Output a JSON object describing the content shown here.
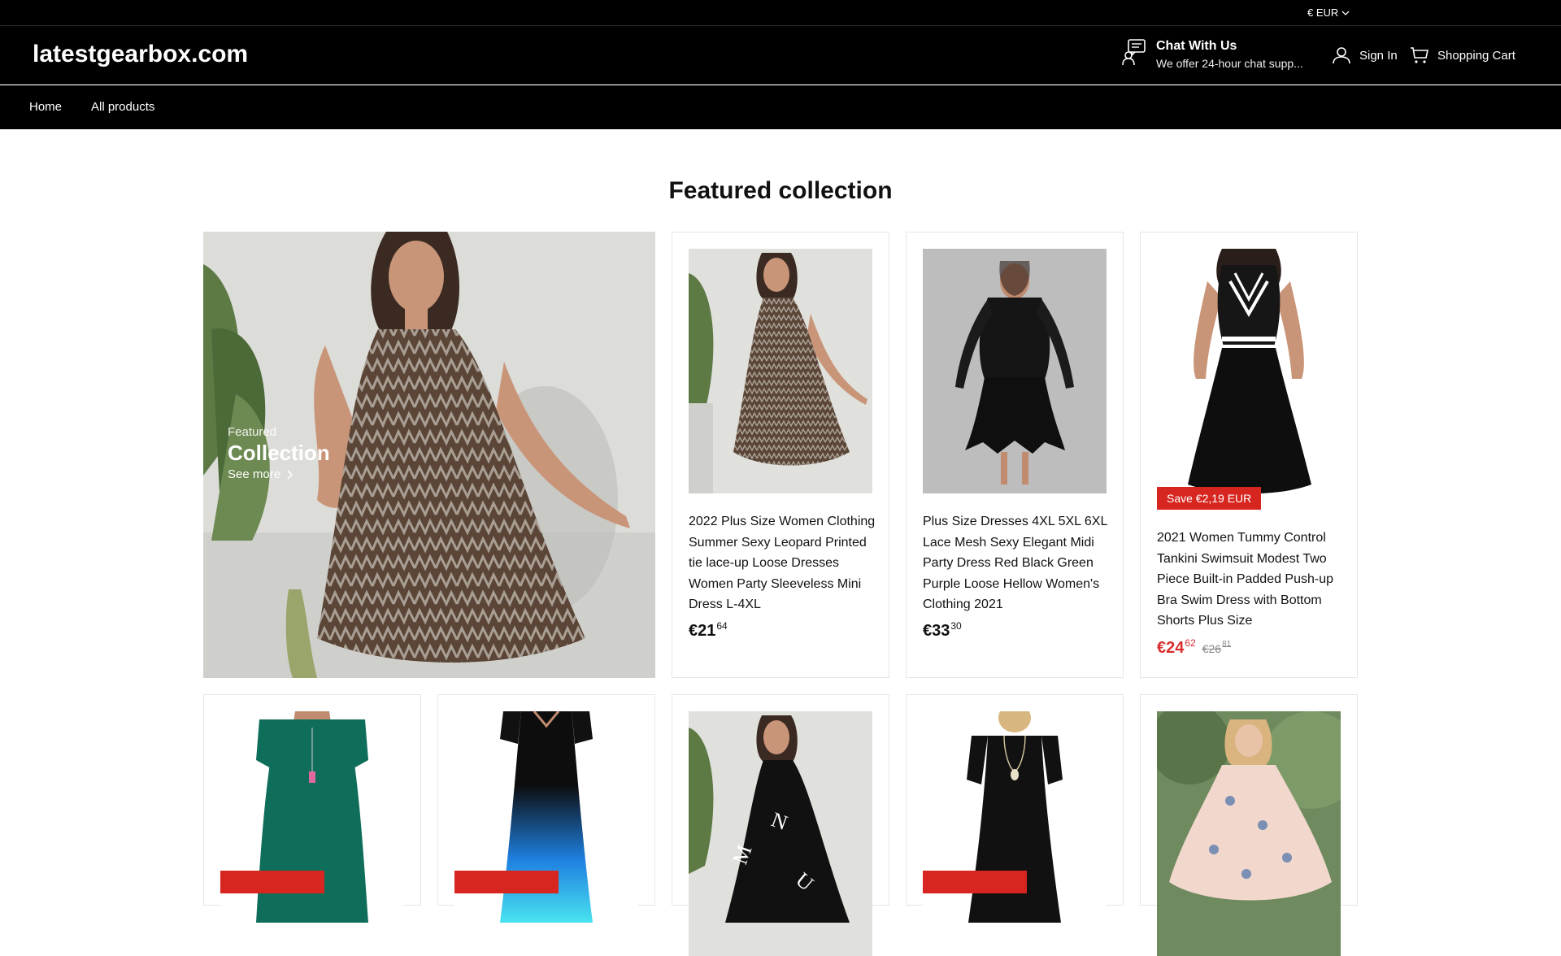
{
  "topbar": {
    "currency": "€ EUR"
  },
  "header": {
    "logo": "latestgearbox.com",
    "chat_title": "Chat With Us",
    "chat_subtitle": "We offer 24-hour chat supp...",
    "sign_in": "Sign In",
    "cart": "Shopping Cart"
  },
  "nav": {
    "items": [
      "Home",
      "All products"
    ]
  },
  "section": {
    "title": "Featured collection"
  },
  "feature": {
    "kicker": "Featured",
    "title": "Collection",
    "link": "See more"
  },
  "products": [
    {
      "title": "2022 Plus Size Women Clothing Summer Sexy Leopard Printed tie lace-up Loose Dresses Women Party Sleeveless Mini Dress L-4XL",
      "price_whole": "€21",
      "price_cents": "64"
    },
    {
      "title": "Plus Size Dresses 4XL 5XL 6XL Lace Mesh Sexy Elegant Midi Party Dress Red Black Green Purple Loose Hellow Women's Clothing 2021",
      "price_whole": "€33",
      "price_cents": "30"
    },
    {
      "title": "2021 Women Tummy Control Tankini Swimsuit Modest Two Piece Built-in Padded Push-up Bra Swim Dress with Bottom Shorts Plus Size",
      "price_whole": "€24",
      "price_cents": "62",
      "orig_whole": "€26",
      "orig_cents": "81",
      "badge": "Save €2,19 EUR"
    }
  ],
  "colors": {
    "header_bg": "#000000",
    "sale_red": "#d72e2e",
    "badge_red": "#d7251f"
  }
}
